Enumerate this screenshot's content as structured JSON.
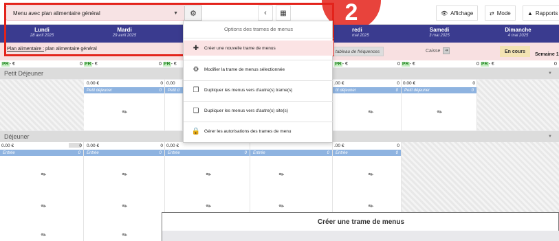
{
  "toolbar": {
    "menu_select": "Menu avec plan alimentaire général",
    "settings_icon": "gear-dropdown-icon",
    "prev_icon": "chevron-left-icon",
    "grid_icon": "calendar-grid-icon",
    "affichage": "Affichage",
    "mode": "Mode",
    "rapports": "Rapports",
    "step_number": "2"
  },
  "days": [
    {
      "name": "Lundi",
      "date": "28 avril 2025"
    },
    {
      "name": "Mardi",
      "date": "29 avril 2025"
    },
    {
      "name": "",
      "date": ""
    },
    {
      "name": "",
      "date": ""
    },
    {
      "name": "redi",
      "date": "mai 2025"
    },
    {
      "name": "Samedi",
      "date": "3 mai 2025"
    },
    {
      "name": "Dimanche",
      "date": "4 mai 2025"
    }
  ],
  "info": {
    "plan_prefix": "Plan alimentaire :",
    "plan_value": "plan alimentaire général",
    "freq": "tableau de fréquences",
    "caisse": "Caisse",
    "status": "En cours",
    "semaine": "Semaine 1"
  },
  "pr": {
    "tag": "PR",
    "value": " - €",
    "zero": "0"
  },
  "sections": {
    "breakfast": "Petit Déjeuner",
    "lunch": "Déjeuner"
  },
  "cells": {
    "amount": "0.00 €",
    "zero": "0",
    "breakfast_label": "Petit déjeuner",
    "entree_label": "Entrée",
    "partial_breakfast": "Petit d",
    "partial_amount": "0.00€",
    "partial_amount_b": "0.00",
    "partial_amount_c": ".00 €",
    "partial_dej": "tit déjeuner"
  },
  "dropdown": {
    "title": "Options des trames de menus",
    "items": [
      {
        "label": "Créer une nouvelle trame de menus",
        "icon": "plus-icon"
      },
      {
        "label": "Modifier la trame de menus sélectionnée",
        "icon": "gear-icon"
      },
      {
        "label": "Dupliquer les menus vers d'autre(s) trame(s)",
        "icon": "copy-icon"
      },
      {
        "label": "Dupliquer les menus vers d'autre(s) site(s)",
        "icon": "copy-building-icon"
      },
      {
        "label": "Gérer les autorisations des trames de menu",
        "icon": "lock-icon"
      }
    ]
  },
  "dialog": {
    "title": "Créer une trame de menus"
  }
}
